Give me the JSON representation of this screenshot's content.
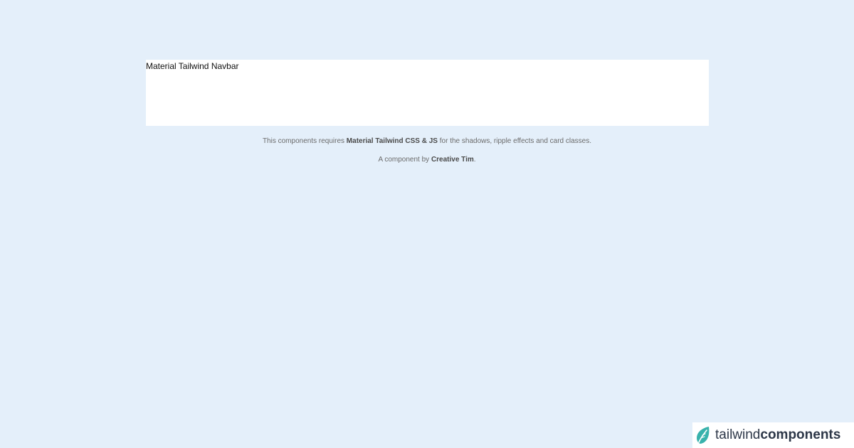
{
  "card": {
    "title": "Material Tailwind Navbar"
  },
  "notes": {
    "line1_prefix": "This components requires ",
    "line1_bold": "Material Tailwind CSS & JS",
    "line1_suffix": " for the shadows, ripple effects and card classes.",
    "line2_prefix": "A component by ",
    "line2_bold": "Creative Tim",
    "line2_suffix": "."
  },
  "brand": {
    "icon": "leaf-icon",
    "text_regular": "tailwind",
    "text_bold": "components",
    "accent_color": "#38b2ac"
  }
}
